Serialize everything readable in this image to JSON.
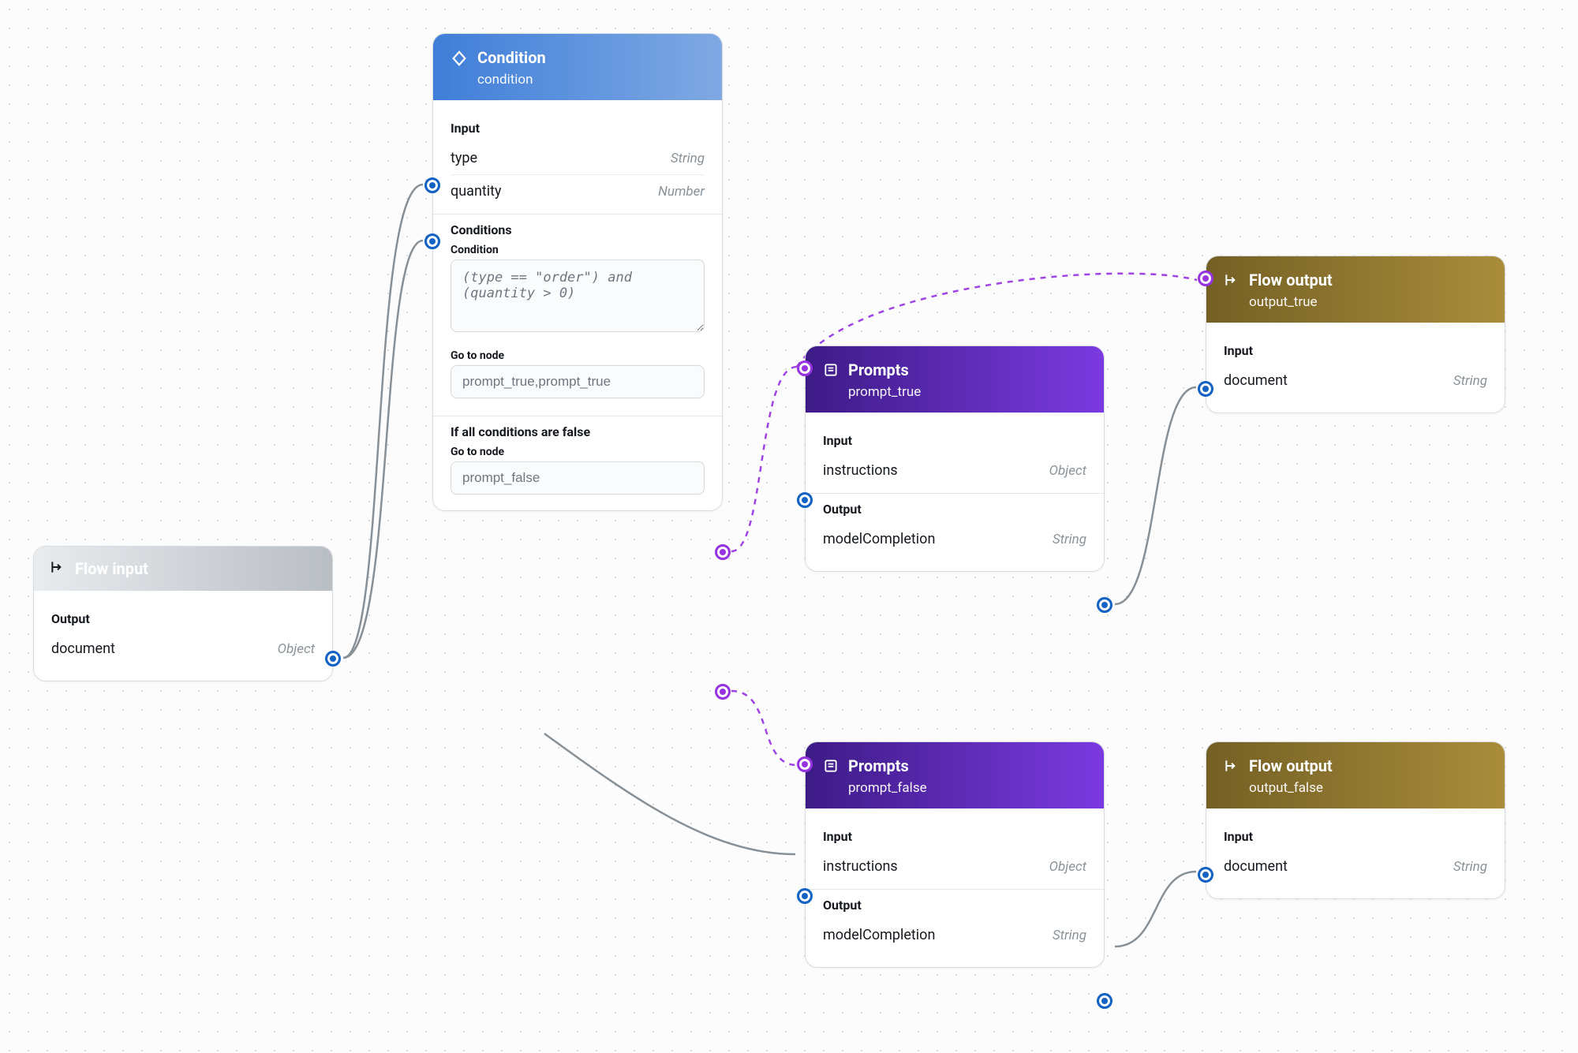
{
  "nodes": {
    "flow_input": {
      "title": "Flow input",
      "section_output": "Output",
      "out_name": "document",
      "out_type": "Object"
    },
    "condition": {
      "title": "Condition",
      "subtitle": "condition",
      "section_input": "Input",
      "in1_name": "type",
      "in1_type": "String",
      "in2_name": "quantity",
      "in2_type": "Number",
      "section_conditions": "Conditions",
      "label_condition": "Condition",
      "condition_expr": "(type == \"order\") and (quantity > 0)",
      "label_goto": "Go to node",
      "goto_true": "prompt_true,prompt_true",
      "section_else": "If all conditions are false",
      "label_goto2": "Go to node",
      "goto_false": "prompt_false"
    },
    "prompt_true": {
      "title": "Prompts",
      "subtitle": "prompt_true",
      "section_input": "Input",
      "in_name": "instructions",
      "in_type": "Object",
      "section_output": "Output",
      "out_name": "modelCompletion",
      "out_type": "String"
    },
    "prompt_false": {
      "title": "Prompts",
      "subtitle": "prompt_false",
      "section_input": "Input",
      "in_name": "instructions",
      "in_type": "Object",
      "section_output": "Output",
      "out_name": "modelCompletion",
      "out_type": "String"
    },
    "output_true": {
      "title": "Flow output",
      "subtitle": "output_true",
      "section_input": "Input",
      "in_name": "document",
      "in_type": "String"
    },
    "output_false": {
      "title": "Flow output",
      "subtitle": "output_false",
      "section_input": "Input",
      "in_name": "document",
      "in_type": "String"
    }
  }
}
